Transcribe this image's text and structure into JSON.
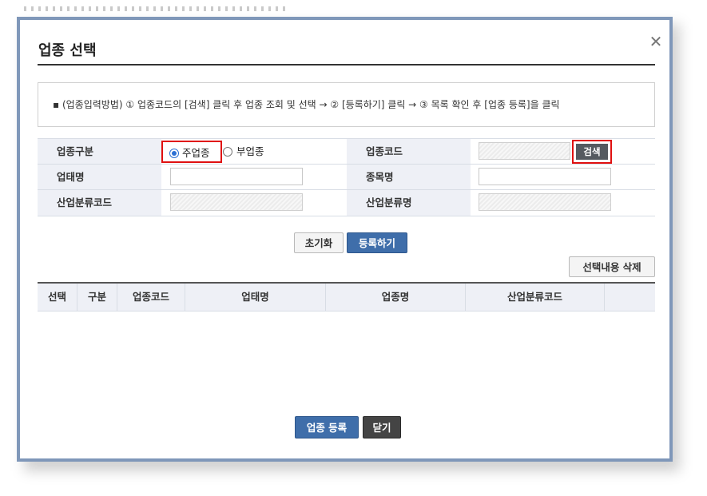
{
  "dialog": {
    "title": "업종 선택",
    "close_symbol": "✕"
  },
  "info": {
    "text": "▪ (업종입력방법) ① 업종코드의 [검색] 클릭 후 업종 조회 및 선택 → ② [등록하기] 클릭 → ③ 목록 확인 후 [업종 등록]을 클릭"
  },
  "form": {
    "type_label": "업종구분",
    "radio_main": "주업종",
    "radio_sub": "부업종",
    "code_label": "업종코드",
    "code_value": "",
    "search_label": "검색",
    "business_label": "업태명",
    "business_value": "",
    "item_label": "종목명",
    "item_value": "",
    "industry_code_label": "산업분류코드",
    "industry_code_value": "",
    "industry_name_label": "산업분류명",
    "industry_name_value": ""
  },
  "actions": {
    "reset": "초기화",
    "register": "등록하기",
    "delete_selected": "선택내용 삭제"
  },
  "table": {
    "headers": [
      "선택",
      "구분",
      "업종코드",
      "업태명",
      "업종명",
      "산업분류코드",
      ""
    ],
    "rows": []
  },
  "footer": {
    "register_business": "업종 등록",
    "close": "닫기"
  },
  "colors": {
    "frame": "#7f97b9",
    "highlight": "#e01010",
    "primary": "#3f6eaa"
  }
}
